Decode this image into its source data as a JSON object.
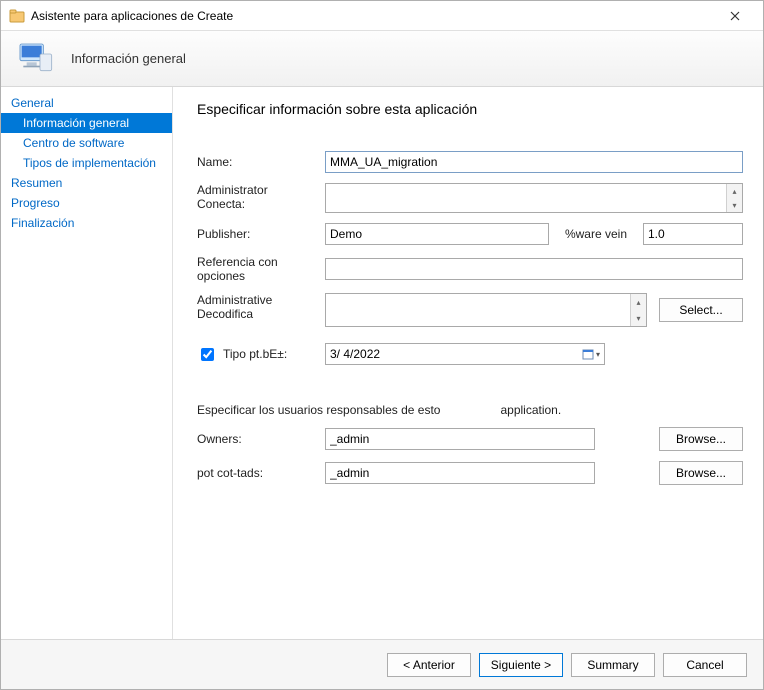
{
  "window": {
    "title": "Asistente para aplicaciones de Create"
  },
  "banner": {
    "title": "Información general"
  },
  "sidebar": {
    "items": [
      {
        "label": "General",
        "level": 0,
        "selected": false
      },
      {
        "label": "Información general",
        "level": 1,
        "selected": true
      },
      {
        "label": "Centro de software",
        "level": 1,
        "selected": false
      },
      {
        "label": "Tipos de implementación",
        "level": 1,
        "selected": false
      },
      {
        "label": "Resumen",
        "level": 0,
        "selected": false
      },
      {
        "label": "Progreso",
        "level": 0,
        "selected": false
      },
      {
        "label": "Finalización",
        "level": 0,
        "selected": false
      }
    ]
  },
  "content": {
    "heading": "Especificar información sobre esta aplicación",
    "labels": {
      "name": "Name:",
      "admin_comments": "Administrator Conecta:",
      "publisher": "Publisher:",
      "version": "%ware vein",
      "optional_ref": "Referencia con opciones",
      "admin_categories": "Administrative Decodifica",
      "date_checkbox": "Tipo pt.bE±:",
      "owners_section_a": "Especificar los usuarios responsables de esto",
      "owners_section_b": "application.",
      "owners": "Owners:",
      "support_contacts": "pot cot-tads:"
    },
    "values": {
      "name": "MMA_UA_migration",
      "admin_comments": "",
      "publisher": "Demo",
      "version": "1.0",
      "optional_ref": "",
      "admin_categories": "",
      "date_checked": true,
      "date": "3/ 4/2022",
      "owners": "_admin",
      "support_contacts": "_admin"
    },
    "buttons": {
      "select": "Select...",
      "browse": "Browse..."
    }
  },
  "footer": {
    "previous": "< Anterior",
    "next": "Siguiente >",
    "summary": "Summary",
    "cancel": "Cancel"
  }
}
